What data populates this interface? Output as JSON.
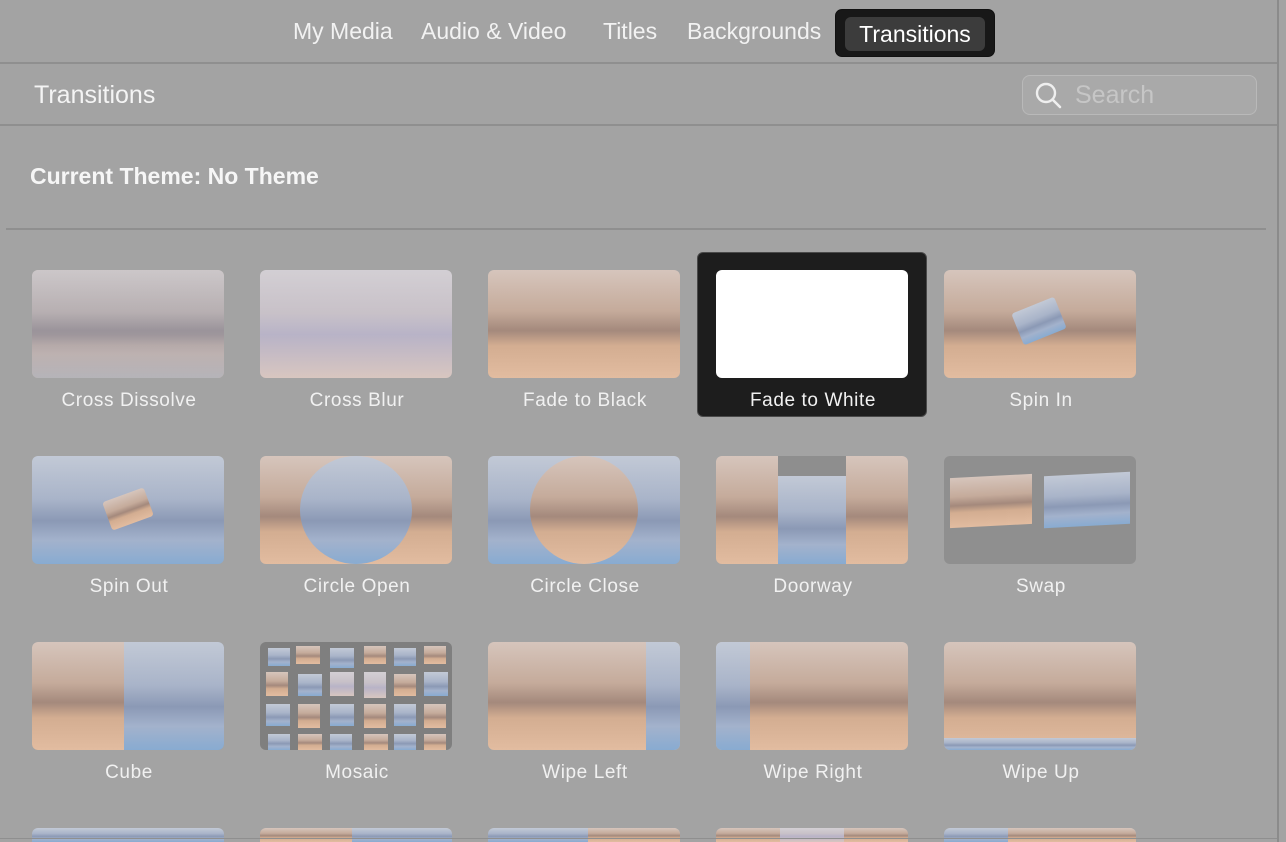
{
  "tabs": {
    "items": [
      "My Media",
      "Audio & Video",
      "Titles",
      "Backgrounds"
    ],
    "active": "Transitions"
  },
  "header": {
    "title": "Transitions",
    "search_placeholder": "Search"
  },
  "theme_label": "Current Theme: No Theme",
  "transitions": [
    {
      "label": "Cross Dissolve",
      "thumb": "cross-dissolve-preview"
    },
    {
      "label": "Cross Blur",
      "thumb": "cross-blur-preview"
    },
    {
      "label": "Fade to Black",
      "thumb": "fade-to-black-preview"
    },
    {
      "label": "Fade to White",
      "thumb": "fade-to-white-preview",
      "selected": true
    },
    {
      "label": "Spin In",
      "thumb": "spin-in-preview"
    },
    {
      "label": "Spin Out",
      "thumb": "spin-out-preview"
    },
    {
      "label": "Circle Open",
      "thumb": "circle-open-preview"
    },
    {
      "label": "Circle Close",
      "thumb": "circle-close-preview"
    },
    {
      "label": "Doorway",
      "thumb": "doorway-preview"
    },
    {
      "label": "Swap",
      "thumb": "swap-preview"
    },
    {
      "label": "Cube",
      "thumb": "cube-preview"
    },
    {
      "label": "Mosaic",
      "thumb": "mosaic-preview"
    },
    {
      "label": "Wipe Left",
      "thumb": "wipe-left-preview"
    },
    {
      "label": "Wipe Right",
      "thumb": "wipe-right-preview"
    },
    {
      "label": "Wipe Up",
      "thumb": "wipe-up-preview"
    }
  ],
  "colors": {
    "background": "#a3a3a3",
    "active_tab": "#181818",
    "selected_tile": "#1d1d1d"
  }
}
